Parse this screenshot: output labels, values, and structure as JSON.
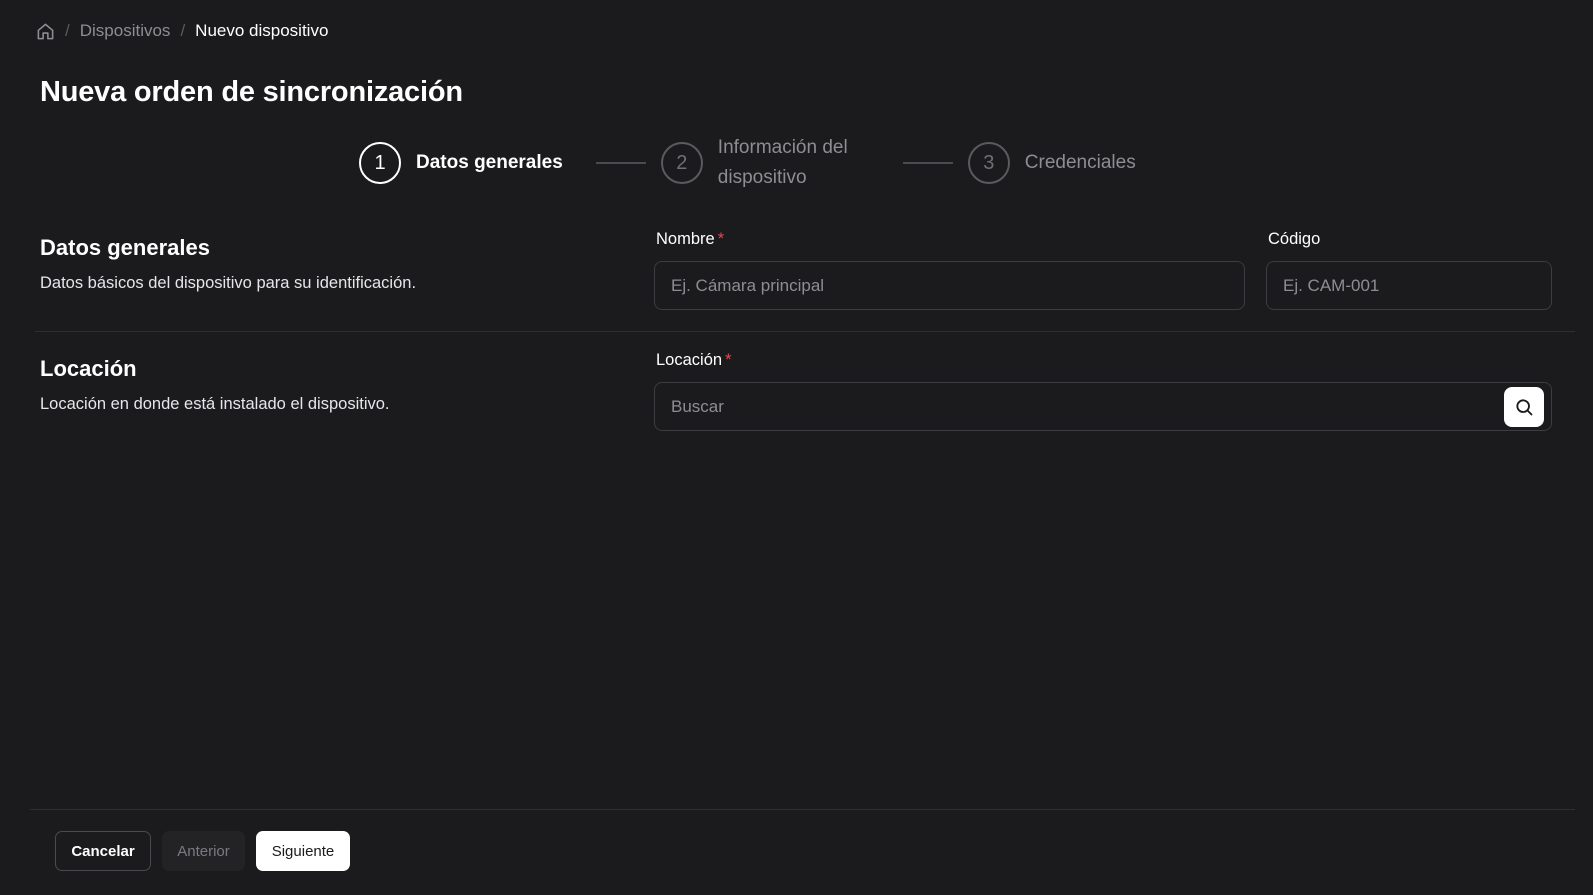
{
  "breadcrumb": {
    "home_icon": "home-icon",
    "items": [
      "Dispositivos",
      "Nuevo dispositivo"
    ],
    "separator": "/"
  },
  "page": {
    "title": "Nueva orden de sincronización"
  },
  "stepper": {
    "steps": [
      {
        "number": "1",
        "label": "Datos generales",
        "active": true
      },
      {
        "number": "2",
        "label": "Información del dispositivo",
        "active": false
      },
      {
        "number": "3",
        "label": "Credenciales",
        "active": false
      }
    ]
  },
  "sections": {
    "general": {
      "title": "Datos generales",
      "description": "Datos básicos del dispositivo para su identificación.",
      "fields": {
        "name": {
          "label": "Nombre",
          "required_mark": "*",
          "placeholder": "Ej. Cámara principal",
          "value": ""
        },
        "code": {
          "label": "Código",
          "placeholder": "Ej. CAM-001",
          "value": ""
        }
      }
    },
    "location": {
      "title": "Locación",
      "description": "Locación en donde está instalado el dispositivo.",
      "fields": {
        "location": {
          "label": "Locación",
          "required_mark": "*",
          "placeholder": "Buscar",
          "value": "",
          "search_icon": "search-icon"
        }
      }
    }
  },
  "footer": {
    "cancel_label": "Cancelar",
    "previous_label": "Anterior",
    "next_label": "Siguiente"
  },
  "colors": {
    "background": "#1b1b1d",
    "required": "#e5484d",
    "border": "#3c3c41"
  }
}
